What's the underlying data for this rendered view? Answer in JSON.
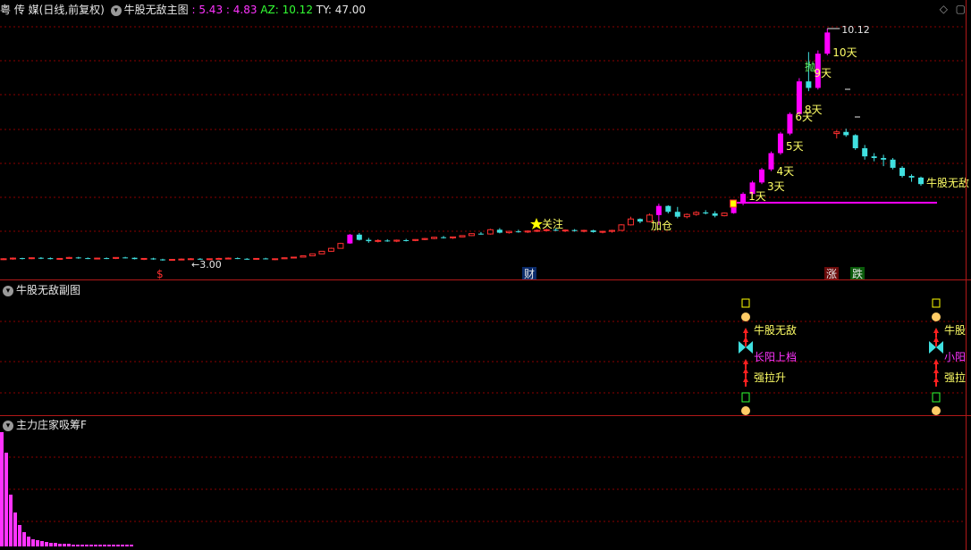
{
  "header": {
    "stock_name": "粤 传 媒",
    "period": "(日线,前复权)",
    "indicator_main": "牛股无敌主图",
    "val1": ": 5.43",
    "val2": ": 4.83",
    "az": "AZ: 10.12",
    "ty": "TY: 47.00"
  },
  "panel2": {
    "title": "牛股无敌副图"
  },
  "panel3": {
    "title": "主力庄家吸筹F"
  },
  "colors": {
    "up": "#ff3030",
    "down": "#40e0e0",
    "bigup": "#ff00ff",
    "grid": "#8b0000",
    "signal_line": "#ff00ff"
  },
  "chart_data": {
    "type": "candlestick",
    "title": "牛股无敌主图",
    "annotations": {
      "high_label": "10.12",
      "low_label": "3.00",
      "tags": [
        "1天",
        "3天",
        "4天",
        "5天",
        "6天",
        "8天",
        "9天",
        "10天"
      ],
      "signals": [
        "关注",
        "加仓",
        "抛",
        "牛股无敌"
      ],
      "bottom_marks": [
        "$",
        "财",
        "涨",
        "跌"
      ]
    },
    "candles": [
      [
        3.05,
        3.08,
        3.02,
        3.06
      ],
      [
        3.06,
        3.1,
        3.03,
        3.08
      ],
      [
        3.08,
        3.09,
        3.04,
        3.07
      ],
      [
        3.07,
        3.1,
        3.05,
        3.09
      ],
      [
        3.09,
        3.11,
        3.05,
        3.08
      ],
      [
        3.08,
        3.1,
        3.04,
        3.05
      ],
      [
        3.05,
        3.08,
        3.03,
        3.07
      ],
      [
        3.07,
        3.12,
        3.06,
        3.1
      ],
      [
        3.1,
        3.12,
        3.06,
        3.08
      ],
      [
        3.08,
        3.1,
        3.05,
        3.06
      ],
      [
        3.06,
        3.09,
        3.04,
        3.08
      ],
      [
        3.08,
        3.1,
        3.05,
        3.07
      ],
      [
        3.07,
        3.11,
        3.05,
        3.1
      ],
      [
        3.1,
        3.12,
        3.07,
        3.09
      ],
      [
        3.09,
        3.1,
        3.04,
        3.05
      ],
      [
        3.05,
        3.08,
        3.02,
        3.07
      ],
      [
        3.07,
        3.09,
        3.03,
        3.04
      ],
      [
        3.04,
        3.06,
        3.0,
        3.02
      ],
      [
        3.02,
        3.05,
        3.0,
        3.04
      ],
      [
        3.04,
        3.07,
        3.02,
        3.05
      ],
      [
        3.05,
        3.08,
        3.03,
        3.06
      ],
      [
        3.06,
        3.08,
        3.03,
        3.04
      ],
      [
        3.04,
        3.07,
        3.02,
        3.06
      ],
      [
        3.06,
        3.09,
        3.04,
        3.07
      ],
      [
        3.07,
        3.1,
        3.05,
        3.08
      ],
      [
        3.08,
        3.1,
        3.05,
        3.06
      ],
      [
        3.06,
        3.08,
        3.03,
        3.05
      ],
      [
        3.05,
        3.08,
        3.03,
        3.07
      ],
      [
        3.07,
        3.09,
        3.04,
        3.05
      ],
      [
        3.05,
        3.07,
        3.02,
        3.06
      ],
      [
        3.06,
        3.1,
        3.05,
        3.09
      ],
      [
        3.09,
        3.12,
        3.07,
        3.11
      ],
      [
        3.11,
        3.16,
        3.1,
        3.15
      ],
      [
        3.15,
        3.22,
        3.14,
        3.21
      ],
      [
        3.21,
        3.3,
        3.2,
        3.29
      ],
      [
        3.29,
        3.4,
        3.28,
        3.38
      ],
      [
        3.38,
        3.55,
        3.37,
        3.53
      ],
      [
        3.53,
        3.82,
        3.52,
        3.8
      ],
      [
        3.8,
        3.85,
        3.62,
        3.64
      ],
      [
        3.64,
        3.7,
        3.55,
        3.6
      ],
      [
        3.6,
        3.66,
        3.56,
        3.62
      ],
      [
        3.62,
        3.66,
        3.58,
        3.6
      ],
      [
        3.6,
        3.65,
        3.57,
        3.63
      ],
      [
        3.63,
        3.67,
        3.59,
        3.62
      ],
      [
        3.62,
        3.66,
        3.6,
        3.65
      ],
      [
        3.65,
        3.7,
        3.63,
        3.68
      ],
      [
        3.68,
        3.73,
        3.66,
        3.72
      ],
      [
        3.72,
        3.76,
        3.68,
        3.7
      ],
      [
        3.7,
        3.74,
        3.67,
        3.73
      ],
      [
        3.73,
        3.78,
        3.72,
        3.77
      ],
      [
        3.77,
        3.84,
        3.76,
        3.83
      ],
      [
        3.83,
        3.88,
        3.8,
        3.82
      ],
      [
        3.82,
        3.98,
        3.8,
        3.95
      ],
      [
        3.95,
        4.0,
        3.84,
        3.86
      ],
      [
        3.86,
        3.92,
        3.83,
        3.9
      ],
      [
        3.9,
        3.95,
        3.86,
        3.88
      ],
      [
        3.88,
        3.93,
        3.85,
        3.91
      ],
      [
        3.91,
        3.96,
        3.88,
        3.93
      ],
      [
        3.93,
        3.98,
        3.9,
        3.95
      ],
      [
        3.95,
        4.0,
        3.91,
        3.92
      ],
      [
        3.92,
        3.96,
        3.88,
        3.94
      ],
      [
        3.94,
        3.97,
        3.89,
        3.91
      ],
      [
        3.91,
        3.95,
        3.87,
        3.93
      ],
      [
        3.93,
        3.95,
        3.86,
        3.88
      ],
      [
        3.88,
        3.92,
        3.84,
        3.9
      ],
      [
        3.9,
        3.95,
        3.86,
        3.93
      ],
      [
        3.93,
        4.12,
        3.92,
        4.1
      ],
      [
        4.1,
        4.35,
        4.08,
        4.28
      ],
      [
        4.28,
        4.3,
        4.15,
        4.2
      ],
      [
        4.2,
        4.45,
        4.18,
        4.4
      ],
      [
        4.4,
        4.75,
        4.1,
        4.68
      ],
      [
        4.68,
        4.7,
        4.45,
        4.5
      ],
      [
        4.5,
        4.65,
        4.3,
        4.35
      ],
      [
        4.35,
        4.45,
        4.3,
        4.42
      ],
      [
        4.42,
        4.52,
        4.38,
        4.48
      ],
      [
        4.48,
        4.55,
        4.42,
        4.45
      ],
      [
        4.45,
        4.52,
        4.33,
        4.38
      ],
      [
        4.38,
        4.48,
        4.36,
        4.46
      ],
      [
        4.46,
        4.8,
        4.44,
        4.75
      ],
      [
        4.75,
        5.1,
        4.7,
        5.05
      ],
      [
        5.05,
        5.45,
        5.0,
        5.4
      ],
      [
        5.4,
        5.85,
        5.35,
        5.8
      ],
      [
        5.8,
        6.35,
        5.75,
        6.3
      ],
      [
        6.3,
        6.95,
        6.25,
        6.9
      ],
      [
        6.9,
        7.55,
        6.85,
        7.5
      ],
      [
        7.5,
        8.6,
        7.45,
        8.5
      ],
      [
        8.5,
        9.4,
        8.2,
        8.3
      ],
      [
        8.3,
        9.45,
        8.25,
        9.35
      ],
      [
        9.35,
        10.12,
        9.3,
        10.0
      ],
      [
        6.9,
        7.0,
        6.75,
        6.95
      ],
      [
        6.95,
        7.05,
        6.8,
        6.85
      ],
      [
        6.85,
        6.88,
        6.4,
        6.45
      ],
      [
        6.45,
        6.55,
        6.1,
        6.2
      ],
      [
        6.2,
        6.3,
        6.05,
        6.15
      ],
      [
        6.15,
        6.25,
        5.9,
        6.1
      ],
      [
        6.1,
        6.15,
        5.8,
        5.85
      ],
      [
        5.85,
        5.9,
        5.55,
        5.6
      ],
      [
        5.6,
        5.65,
        5.42,
        5.55
      ],
      [
        5.55,
        5.58,
        5.3,
        5.35
      ]
    ]
  }
}
